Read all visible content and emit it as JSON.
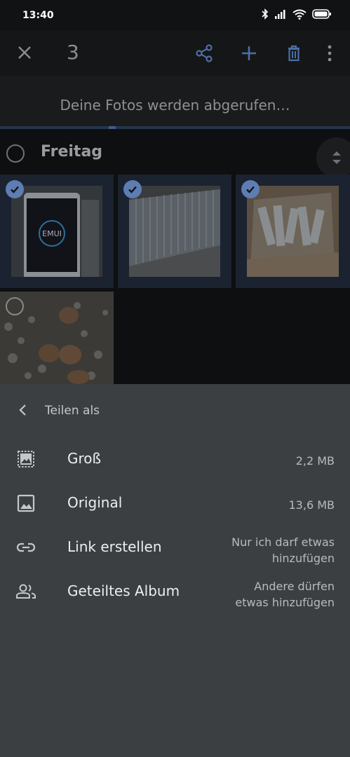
{
  "status": {
    "time": "13:40"
  },
  "topbar": {
    "selected_count": "3"
  },
  "banner": {
    "text": "Deine Fotos werden abgerufen…"
  },
  "date_group": {
    "label": "Freitag"
  },
  "sheet": {
    "title": "Teilen als",
    "options": [
      {
        "label": "Groß",
        "meta_line1": "2,2 MB",
        "meta_line2": ""
      },
      {
        "label": "Original",
        "meta_line1": "13,6 MB",
        "meta_line2": ""
      },
      {
        "label": "Link erstellen",
        "meta_line1": "Nur ich darf etwas",
        "meta_line2": "hinzufügen"
      },
      {
        "label": "Geteiltes Album",
        "meta_line1": "Andere dürfen",
        "meta_line2": "etwas hinzufügen"
      }
    ]
  },
  "photo1": {
    "screen_text": "EMUI"
  }
}
